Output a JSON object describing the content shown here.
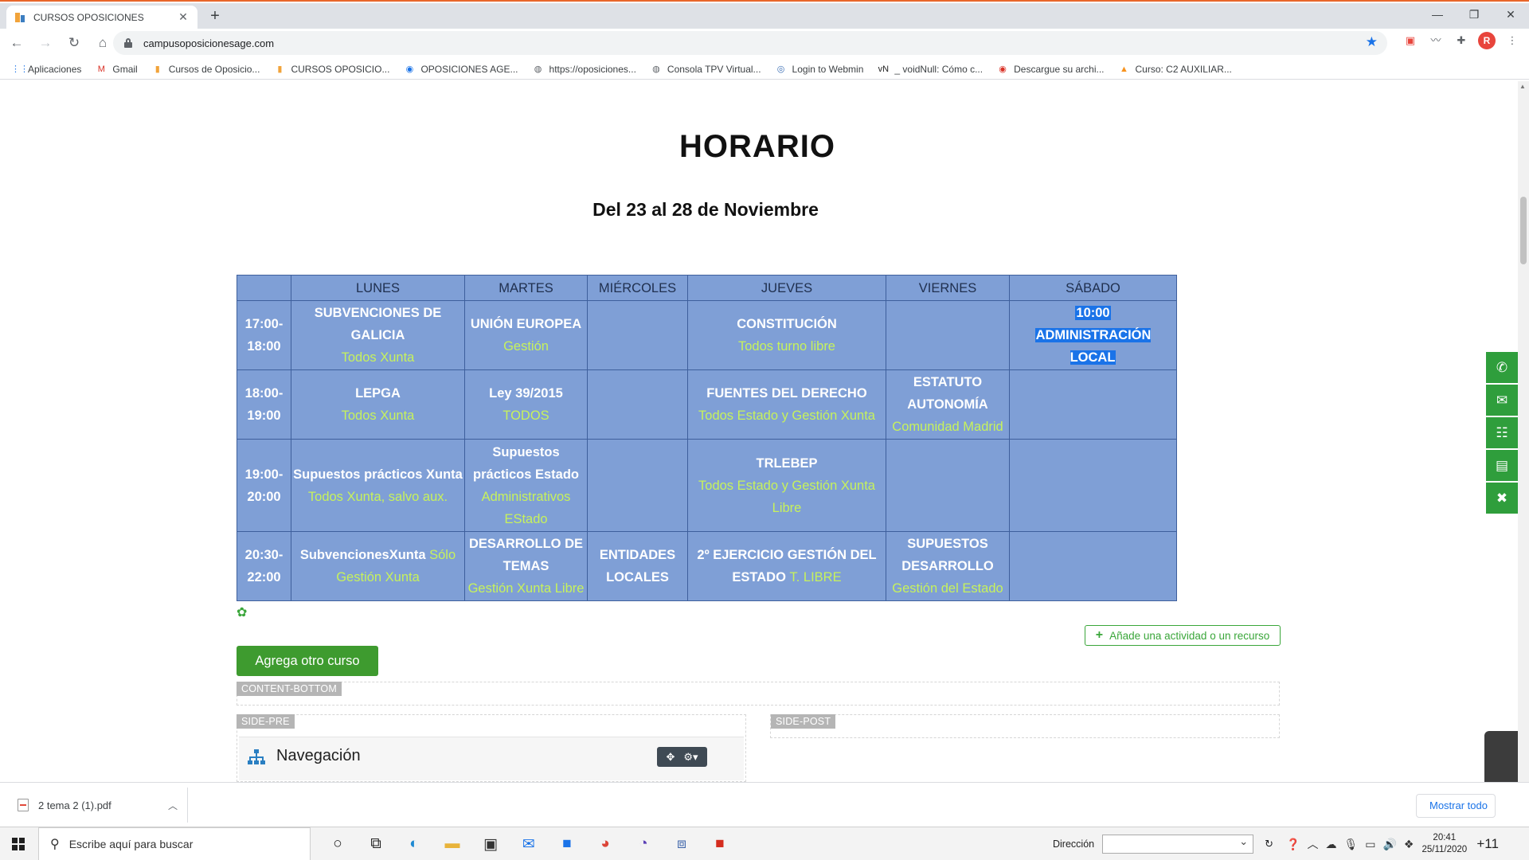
{
  "browser": {
    "tab_title": "CURSOS OPOSICIONES",
    "tab_close": "✕",
    "new_tab": "+",
    "url": "campusoposicionesage.com",
    "window_controls": [
      "—",
      "❐",
      "✕"
    ],
    "bookmarks": [
      {
        "label": "Aplicaciones",
        "icon": "apps-grid-icon",
        "glyph": "⋮⋮",
        "color": "#1a73e8"
      },
      {
        "label": "Gmail",
        "icon": "gmail-icon",
        "glyph": "M",
        "color": "#d93025"
      },
      {
        "label": "Cursos de Oposicio...",
        "icon": "site-favicon-icon",
        "glyph": "▮",
        "color": "#f1a33a"
      },
      {
        "label": "CURSOS OPOSICIO...",
        "icon": "site-favicon-icon",
        "glyph": "▮",
        "color": "#f1a33a"
      },
      {
        "label": "OPOSICIONES AGE...",
        "icon": "circle-logo-icon",
        "glyph": "◉",
        "color": "#1a73e8"
      },
      {
        "label": "https://oposiciones...",
        "icon": "globe-icon",
        "glyph": "◍",
        "color": "#5f6368"
      },
      {
        "label": "Consola TPV Virtual...",
        "icon": "globe-icon",
        "glyph": "◍",
        "color": "#5f6368"
      },
      {
        "label": "Login to Webmin",
        "icon": "webmin-icon",
        "glyph": "◎",
        "color": "#3c6fb5"
      },
      {
        "label": "_ voidNull: Cómo c...",
        "icon": "voidnull-icon",
        "glyph": "vN",
        "color": "#222222"
      },
      {
        "label": "Descargue su archi...",
        "icon": "red-circle-icon",
        "glyph": "◉",
        "color": "#d93025"
      },
      {
        "label": "Curso: C2 AUXILIAR...",
        "icon": "moodle-icon",
        "glyph": "▲",
        "color": "#f7931e"
      }
    ]
  },
  "page": {
    "title": "HORARIO",
    "subtitle": "Del 23 al 28 de Noviembre",
    "schedule": {
      "headers": [
        "",
        "LUNES",
        "MARTES",
        "MIÉRCOLES",
        "JUEVES",
        "VIERNES",
        "SÁBADO"
      ],
      "rows": [
        {
          "time": [
            "17:00-",
            "18:00"
          ],
          "cells": [
            {
              "course": [
                "SUBVENCIONES DE",
                "GALICIA"
              ],
              "group": [
                "Todos Xunta"
              ]
            },
            {
              "course": [
                "UNIÓN EUROPEA"
              ],
              "group": [
                "Gestión"
              ]
            },
            {
              "course": [],
              "group": []
            },
            {
              "course": [
                "CONSTITUCIÓN"
              ],
              "group": [
                "Todos turno libre"
              ]
            },
            {
              "course": [],
              "group": []
            },
            {
              "course": [
                "10:00",
                "ADMINISTRACIÓN LOCAL"
              ],
              "group": [],
              "selected": true
            }
          ]
        },
        {
          "time": [
            "18:00-",
            "19:00"
          ],
          "cells": [
            {
              "course": [
                "LEPGA"
              ],
              "group": [
                "Todos Xunta"
              ]
            },
            {
              "course": [
                "Ley 39/2015"
              ],
              "group": [
                "TODOS"
              ]
            },
            {
              "course": [],
              "group": []
            },
            {
              "course": [
                "FUENTES DEL DERECHO"
              ],
              "group": [
                "Todos Estado y Gestión Xunta"
              ]
            },
            {
              "course": [
                "ESTATUTO",
                "AUTONOMÍA"
              ],
              "group": [
                "Comunidad Madrid"
              ]
            },
            {
              "course": [],
              "group": []
            }
          ]
        },
        {
          "time": [
            "19:00-",
            "20:00"
          ],
          "cells": [
            {
              "course": [
                "Supuestos prácticos Xunta"
              ],
              "group": [
                "Todos Xunta, salvo aux."
              ]
            },
            {
              "course": [
                "Supuestos",
                "prácticos Estado"
              ],
              "group": [
                "Administrativos",
                "EStado"
              ]
            },
            {
              "course": [],
              "group": []
            },
            {
              "course": [
                "TRLEBEP"
              ],
              "group": [
                "Todos Estado y Gestión Xunta",
                "Libre"
              ]
            },
            {
              "course": [],
              "group": []
            },
            {
              "course": [],
              "group": []
            }
          ]
        },
        {
          "time": [
            "20:30-",
            "22:00"
          ],
          "cells": [
            {
              "mixed": [
                [
                  "SubvencionesXunta ",
                  "Sólo"
                ],
                [
                  "",
                  "Gestión Xunta"
                ]
              ]
            },
            {
              "course": [
                "DESARROLLO DE",
                "TEMAS"
              ],
              "group": [
                "Gestión Xunta Libre"
              ]
            },
            {
              "course": [
                "ENTIDADES",
                "LOCALES"
              ],
              "group": []
            },
            {
              "mixed": [
                [
                  "2º EJERCICIO GESTIÓN DEL",
                  ""
                ],
                [
                  "ESTADO ",
                  "T. LIBRE"
                ]
              ]
            },
            {
              "course": [
                "SUPUESTOS",
                "DESARROLLO"
              ],
              "group": [
                "Gestión del Estado"
              ]
            },
            {
              "course": [],
              "group": []
            }
          ]
        }
      ]
    },
    "add_activity_label": "Añade una actividad o un recurso",
    "add_course_label": "Agrega otro curso",
    "regions": {
      "content_bottom": "CONTENT-BOTTOM",
      "side_pre": "SIDE-PRE",
      "side_post": "SIDE-POST"
    },
    "nav_block_title": "Navegación"
  },
  "side_buttons": [
    {
      "name": "whatsapp-icon",
      "glyph": "✆"
    },
    {
      "name": "mail-icon",
      "glyph": "✉"
    },
    {
      "name": "sitemap-icon",
      "glyph": "☷"
    },
    {
      "name": "book-icon",
      "glyph": "▤"
    },
    {
      "name": "close-icon",
      "glyph": "✖"
    }
  ],
  "downloads": {
    "file_name": "2 tema 2 (1).pdf",
    "show_all": "Mostrar todo"
  },
  "taskbar": {
    "search_placeholder": "Escribe aquí para buscar",
    "address_label": "Dirección",
    "time": "20:41",
    "date": "25/11/2020",
    "notifications": "+11"
  },
  "colors": {
    "table_bg": "#7f9fd6",
    "group_text": "#c7f25c",
    "accent_green": "#3e9b2f",
    "selection": "#1a73e8"
  }
}
